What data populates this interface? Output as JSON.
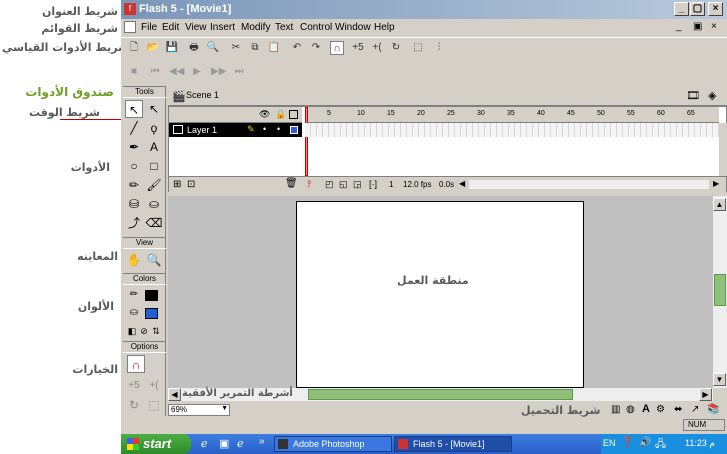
{
  "annotations": {
    "title_bar": "شريط العنوان",
    "menu_bar": "شريط القوائم",
    "standard_toolbar": "شريط الأدوات القياسي",
    "toolbox": "صندوق الأدوات",
    "timeline": "شريط الوقت",
    "tools": "الأدوات",
    "view": "المعاينه",
    "colors": "الألوان",
    "options": "الخيارات",
    "work_area": "منطقة العمل",
    "h_scrollbar": "أشرطة التمرير الأفقية",
    "status_bar": "شريط التحميل"
  },
  "window": {
    "title": "Flash 5 - [Movie1]"
  },
  "menu": [
    "File",
    "Edit",
    "View",
    "Insert",
    "Modify",
    "Text",
    "Control",
    "Window",
    "Help"
  ],
  "toolbox": {
    "tools_label": "Tools",
    "view_label": "View",
    "colors_label": "Colors",
    "options_label": "Options",
    "stroke_color": "#000000",
    "fill_color": "#1f5fd0"
  },
  "scene": {
    "label": "Scene 1"
  },
  "timeline": {
    "ruler": [
      "5",
      "10",
      "15",
      "20",
      "25",
      "30",
      "35",
      "40",
      "45",
      "50",
      "55",
      "60",
      "65"
    ],
    "layer_name": "Layer 1",
    "current_frame": "1",
    "frame_rate": "12.0 fps",
    "elapsed": "0.0s"
  },
  "zoom": "69%",
  "status": {
    "num": "NUM"
  },
  "taskbar": {
    "start": "start",
    "tasks": [
      "Adobe Photoshop",
      "Flash 5 - [Movie1]"
    ],
    "lang": "EN",
    "clock": "11:23 م"
  }
}
